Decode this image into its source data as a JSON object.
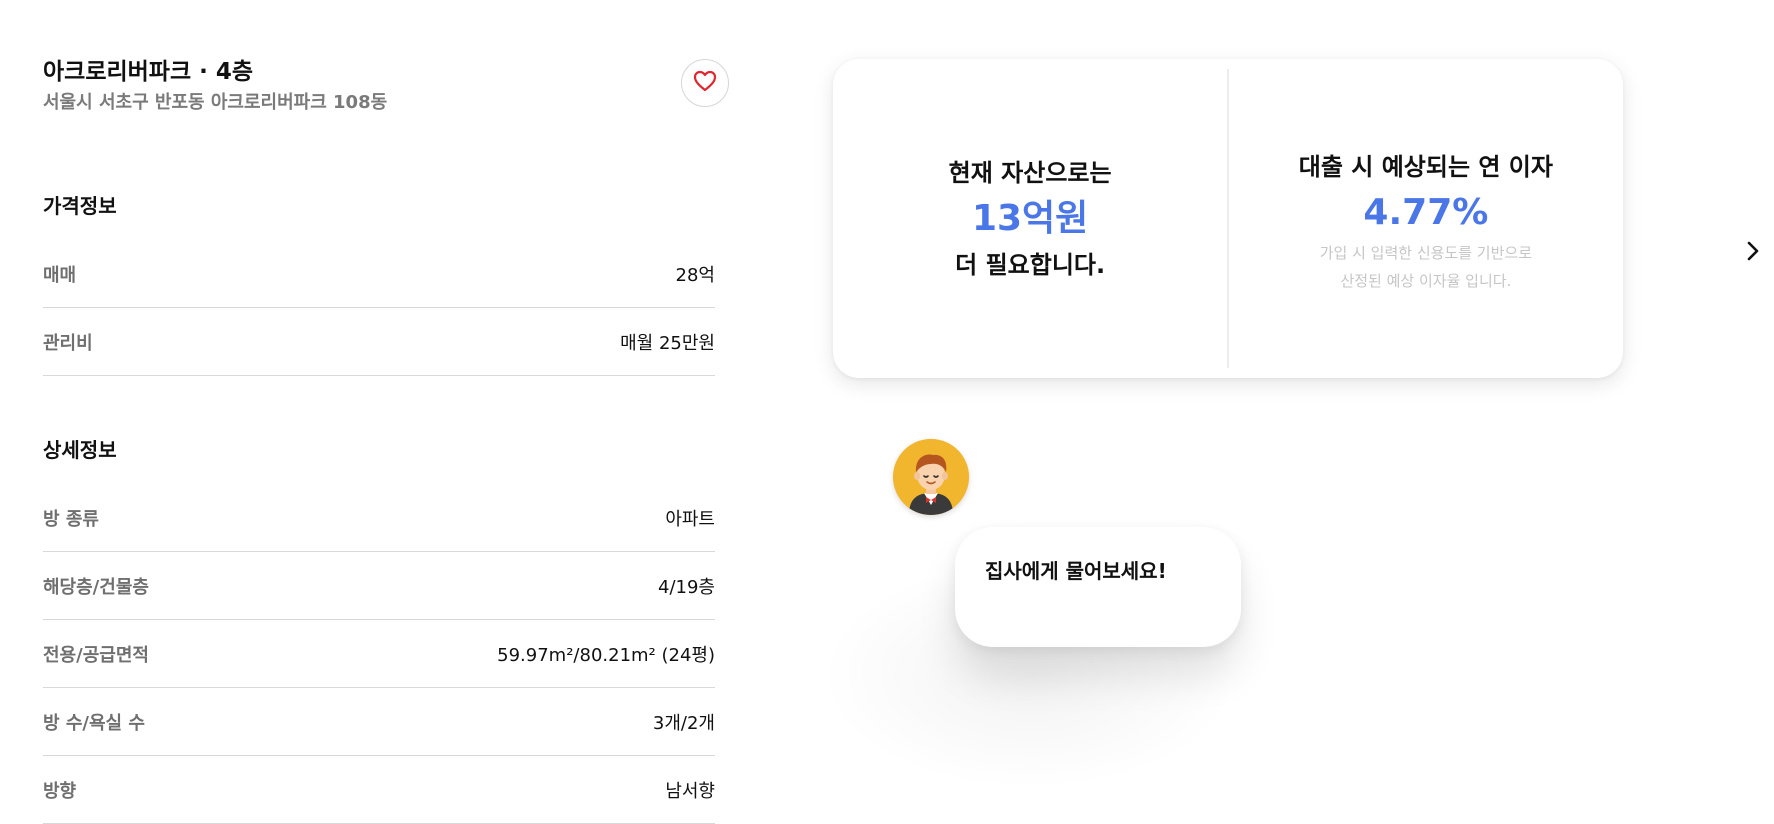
{
  "listing": {
    "title": "아크로리버파크 · 4층",
    "address": "서울시 서초구 반포동 아크로리버파크 108동"
  },
  "price_section": {
    "title": "가격정보",
    "rows": [
      {
        "label": "매매",
        "value": "28억"
      },
      {
        "label": "관리비",
        "value": "매월 25만원"
      }
    ]
  },
  "detail_section": {
    "title": "상세정보",
    "rows": [
      {
        "label": "방 종류",
        "value": "아파트"
      },
      {
        "label": "해당층/건물층",
        "value": "4/19층"
      },
      {
        "label": "전용/공급면적",
        "value": "59.97m²/80.21m² (24평)"
      },
      {
        "label": "방 수/욕실 수",
        "value": "3개/2개"
      },
      {
        "label": "방향",
        "value": "남서향"
      }
    ]
  },
  "summary_card": {
    "asset": {
      "line1": "현재 자산으로는",
      "amount": "13억원",
      "line2": "더 필요합니다."
    },
    "loan": {
      "title": "대출 시 예상되는 연 이자",
      "rate": "4.77%",
      "note_line1": "가입 시 입력한 신용도를 기반으로",
      "note_line2": "산정된 예상 이자율 입니다."
    }
  },
  "assistant": {
    "message": "집사에게 물어보세요!"
  },
  "icons": {
    "favorite": "heart-icon",
    "next": "chevron-right-icon",
    "assistant": "butler-avatar"
  },
  "colors": {
    "accent": "#4a76e8",
    "heart": "#e0262f",
    "avatar_bg": "#f2b52e"
  }
}
